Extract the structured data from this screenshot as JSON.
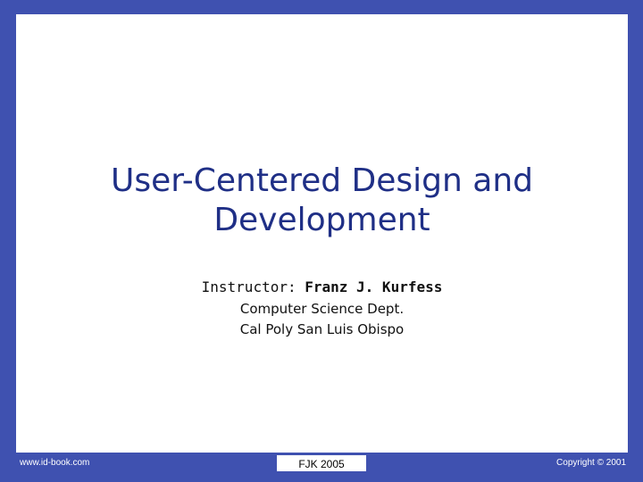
{
  "slide": {
    "title_line1": "User-Centered Design and",
    "title_line2": "Development",
    "instructor_label": "Instructor: ",
    "instructor_name": "Franz J. Kurfess",
    "department": "Computer Science Dept.",
    "university": "Cal Poly San Luis Obispo"
  },
  "footer": {
    "left": "www.id-book.com",
    "center": "FJK 2005",
    "right": "Copyright © 2001"
  },
  "colors": {
    "frame": "#3f51b0",
    "title": "#1f2f86"
  }
}
